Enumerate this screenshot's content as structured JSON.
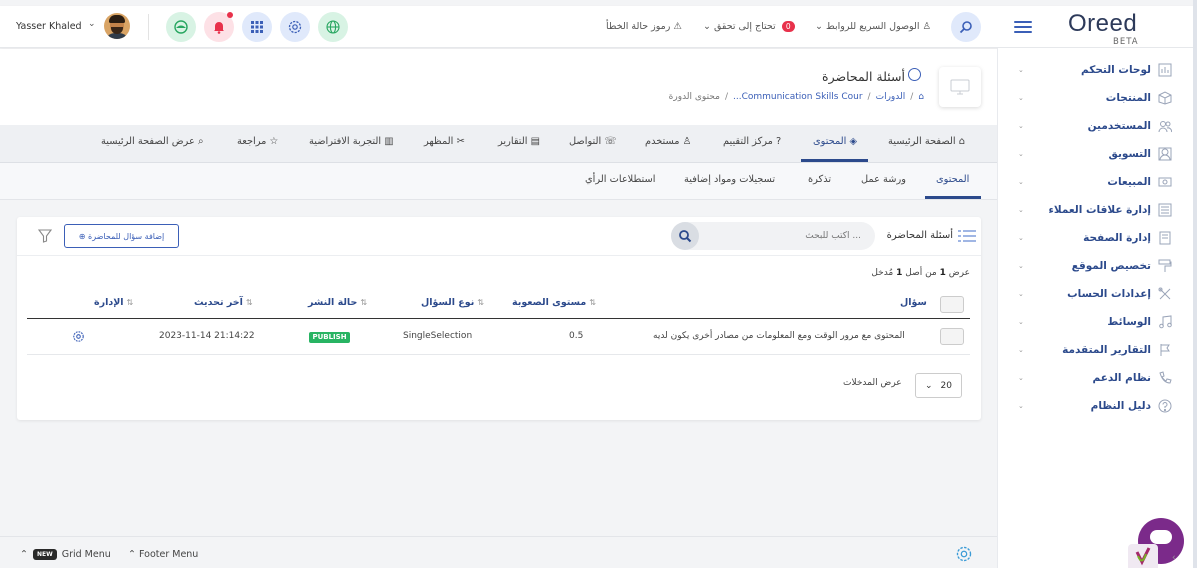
{
  "topbar": {
    "user_name": "Yasser Khaled",
    "links": {
      "error_codes": "رموز حالة الخطأ",
      "needs_verify": "تحتاج إلى تحقق",
      "needs_verify_count": "0",
      "quick_access": "الوصول السريع للروابط"
    },
    "logo": "Oreed",
    "logo_sub": "BETA"
  },
  "sidebar": {
    "items": [
      {
        "label": "لوحات التحكم",
        "icon": "dashboard-icon"
      },
      {
        "label": "المنتجات",
        "icon": "box-icon"
      },
      {
        "label": "المستخدمين",
        "icon": "users-icon"
      },
      {
        "label": "التسويق",
        "icon": "marketing-icon"
      },
      {
        "label": "المبيعات",
        "icon": "sales-icon"
      },
      {
        "label": "إدارة علاقات العملاء",
        "icon": "crm-icon"
      },
      {
        "label": "إدارة الصفحة",
        "icon": "page-icon"
      },
      {
        "label": "تخصيص الموقع",
        "icon": "paint-roller-icon"
      },
      {
        "label": "إعدادات الحساب",
        "icon": "tools-icon"
      },
      {
        "label": "الوسائط",
        "icon": "music-icon"
      },
      {
        "label": "التقارير المتقدمة",
        "icon": "flag-icon"
      },
      {
        "label": "نظام الدعم",
        "icon": "phone-icon"
      },
      {
        "label": "دليل النظام",
        "icon": "help-icon"
      }
    ]
  },
  "page": {
    "title": "أسئلة المحاضرة",
    "breadcrumb": {
      "home": "⌂",
      "courses": "الدورات",
      "course": "Communication Skills Cour...",
      "current": "محتوى الدورة"
    }
  },
  "tabs": [
    {
      "label": "الصفحة الرئيسية",
      "icon": "⌂"
    },
    {
      "label": "المحتوى",
      "icon": "◈"
    },
    {
      "label": "مركز التقييم",
      "icon": "?"
    },
    {
      "label": "مستخدم",
      "icon": "♙"
    },
    {
      "label": "التواصل",
      "icon": "☏"
    },
    {
      "label": "التقارير",
      "icon": "▤"
    },
    {
      "label": "المظهر",
      "icon": "✂"
    },
    {
      "label": "التجربة الافتراضية",
      "icon": "▥"
    },
    {
      "label": "مراجعة",
      "icon": "☆"
    },
    {
      "label": "عرض الصفحة الرئيسية",
      "icon": "⌕"
    }
  ],
  "subtabs": [
    {
      "label": "المحتوى"
    },
    {
      "label": "ورشة عمل"
    },
    {
      "label": "تذكرة"
    },
    {
      "label": "تسجيلات ومواد إضافية"
    },
    {
      "label": "استطلاعات الرأي"
    }
  ],
  "card": {
    "title": "أسئلة المحاضرة",
    "search_placeholder": "اكتب للبحث ...",
    "add_button": "⊕ إضافة سؤال للمحاضرة",
    "count_text_prefix": "عرض",
    "count_shown": "1",
    "count_mid": "من أصل",
    "count_total": "1",
    "count_suffix": "مُدخل"
  },
  "table": {
    "columns": {
      "question": "سؤال",
      "difficulty": "مستوى الصعوبة",
      "type": "نوع السؤال",
      "status": "حالة النشر",
      "updated": "آخر تحديث",
      "admin": "الإدارة"
    },
    "rows": [
      {
        "question": "المحتوى مع مرور الوقت ومع المعلومات من مصادر أخرى يكون لديه",
        "difficulty": "0.5",
        "type": "SingleSelection",
        "status": "PUBLISH",
        "updated": "2023-11-14 21:14:22"
      }
    ]
  },
  "pager": {
    "label": "عرض المدخلات",
    "value": "20"
  },
  "footer": {
    "grid_menu": "Grid Menu",
    "new_badge": "NEW",
    "footer_menu": "Footer Menu"
  },
  "colors": {
    "primary": "#2c4a8c",
    "accent": "#3b5fb7",
    "publish": "#28b463",
    "alert": "#e8314b"
  }
}
